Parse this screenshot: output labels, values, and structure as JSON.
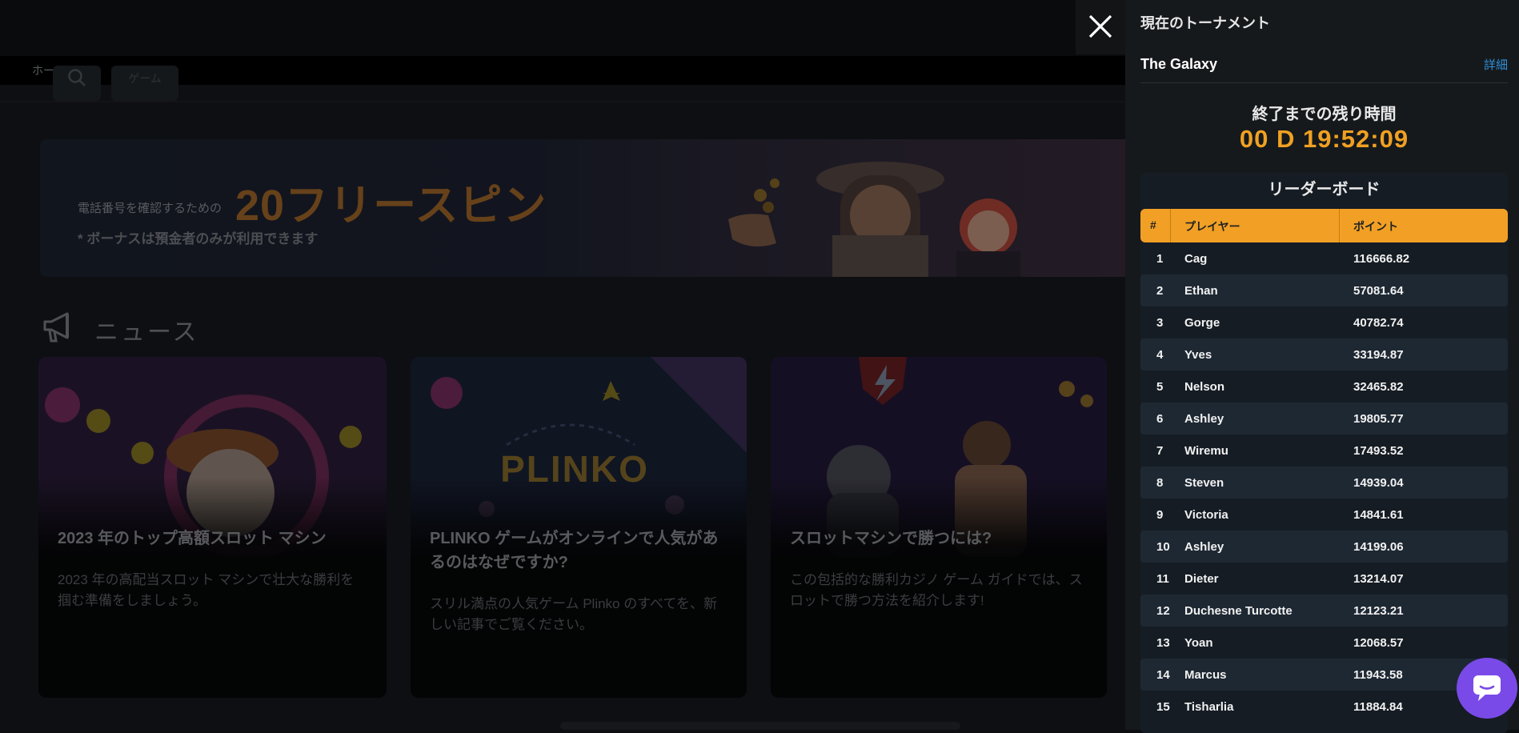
{
  "nav": {
    "home_label": "ホーム",
    "games_label": "ゲーム"
  },
  "banner": {
    "pre_text": "電話番号を確認するための",
    "highlight": "20フリースピン",
    "note": "* ボーナスは預金者のみが利用できます"
  },
  "news": {
    "title": "ニュース",
    "cards": [
      {
        "title": "2023 年のトップ高額スロット マシン",
        "desc": "2023 年の高配当スロット マシンで壮大な勝利を掴む準備をしましょう。"
      },
      {
        "title": "PLINKO ゲームがオンラインで人気があるのはなぜですか?",
        "desc": "スリル満点の人気ゲーム Plinko のすべてを、新しい記事でご覧ください。"
      },
      {
        "title": "スロットマシンで勝つには?",
        "desc": "この包括的な勝利カジノ ゲーム ガイドでは、スロットで勝つ方法を紹介します!"
      }
    ],
    "card2_logo": "PLINKO"
  },
  "drawer": {
    "title": "現在のトーナメント",
    "tournament_name": "The Galaxy",
    "detail_link": "詳細",
    "remaining_label": "終了までの残り時間",
    "timer": "00 D 19:52:09",
    "leaderboard": {
      "title": "リーダーボード",
      "headers": {
        "rank": "#",
        "player": "プレイヤー",
        "points": "ポイント"
      },
      "rows": [
        {
          "rank": "1",
          "player": "Cag",
          "points": "116666.82"
        },
        {
          "rank": "2",
          "player": "Ethan",
          "points": "57081.64"
        },
        {
          "rank": "3",
          "player": "Gorge",
          "points": "40782.74"
        },
        {
          "rank": "4",
          "player": "Yves",
          "points": "33194.87"
        },
        {
          "rank": "5",
          "player": "Nelson",
          "points": "32465.82"
        },
        {
          "rank": "6",
          "player": "Ashley",
          "points": "19805.77"
        },
        {
          "rank": "7",
          "player": "Wiremu",
          "points": "17493.52"
        },
        {
          "rank": "8",
          "player": "Steven",
          "points": "14939.04"
        },
        {
          "rank": "9",
          "player": "Victoria",
          "points": "14841.61"
        },
        {
          "rank": "10",
          "player": "Ashley",
          "points": "14199.06"
        },
        {
          "rank": "11",
          "player": "Dieter",
          "points": "13214.07"
        },
        {
          "rank": "12",
          "player": "Duchesne Turcotte",
          "points": "12123.21"
        },
        {
          "rank": "13",
          "player": "Yoan",
          "points": "12068.57"
        },
        {
          "rank": "14",
          "player": "Marcus",
          "points": "11943.58"
        },
        {
          "rank": "15",
          "player": "Tisharlia",
          "points": "11884.84"
        }
      ]
    }
  },
  "colors": {
    "accent": "#f1a025",
    "link": "#2e8fd8",
    "chat": "#7a4ae8"
  },
  "icons": {
    "close": "close-icon",
    "chat": "chat-icon",
    "news": "megaphone-icon",
    "search": "search-icon"
  }
}
